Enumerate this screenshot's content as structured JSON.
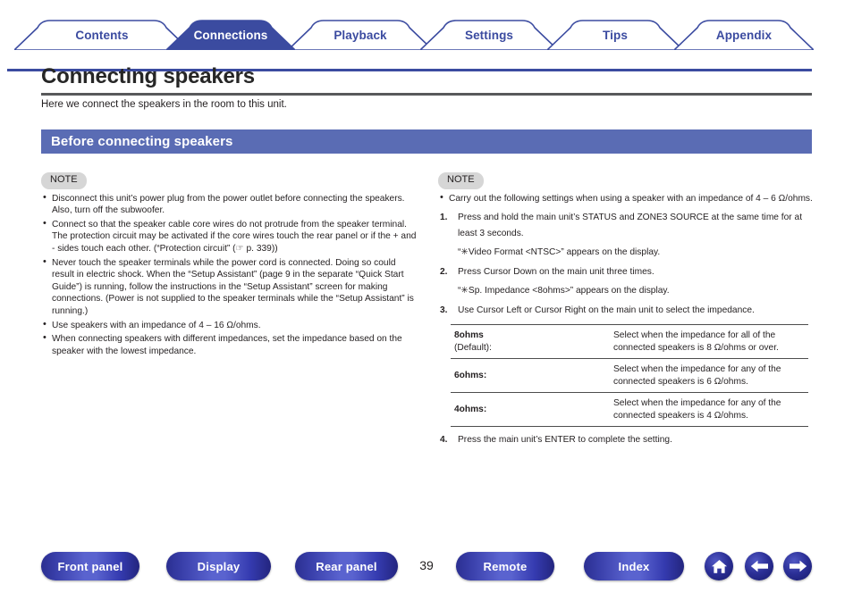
{
  "nav": {
    "tabs": [
      {
        "label": "Contents",
        "active": false
      },
      {
        "label": "Connections",
        "active": true
      },
      {
        "label": "Playback",
        "active": false
      },
      {
        "label": "Settings",
        "active": false
      },
      {
        "label": "Tips",
        "active": false
      },
      {
        "label": "Appendix",
        "active": false
      }
    ]
  },
  "page": {
    "title": "Connecting speakers",
    "lead": "Here we connect the speakers in the room to this unit.",
    "section_heading": "Before connecting speakers",
    "number": "39"
  },
  "left_column": {
    "note_label": "NOTE",
    "bullets": [
      "Disconnect this unit’s power plug from the power outlet before connecting the speakers. Also, turn off the subwoofer.",
      "Connect so that the speaker cable core wires do not protrude from the speaker terminal. The protection circuit may be activated if the core wires touch the rear panel or if the + and - sides touch each other. (“Protection circuit” (☞ p. 339))",
      "Never touch the speaker terminals while the power cord is connected. Doing so could result in electric shock. When the “Setup Assistant” (page 9 in the separate “Quick Start Guide”) is running, follow the instructions in the “Setup Assistant” screen for making connections. (Power is not supplied to the speaker terminals while the “Setup Assistant” is running.)",
      "Use speakers with an impedance of 4 – 16 Ω/ohms.",
      "When connecting speakers with different impedances, set the impedance based on the speaker with the lowest impedance."
    ]
  },
  "right_column": {
    "note_label": "NOTE",
    "intro_bullet": "Carry out the following settings when using a speaker with an impedance of 4 – 6 Ω/ohms.",
    "steps": [
      {
        "number": "1.",
        "text": "Press and hold the main unit’s STATUS and ZONE3 SOURCE at the same time for at least 3 seconds.",
        "result": "“✳Video Format <NTSC>” appears on the display."
      },
      {
        "number": "2.",
        "text": "Press Cursor Down on the main unit three times.",
        "result": "“✳Sp. Impedance <8ohms>” appears on the display."
      },
      {
        "number": "3.",
        "text": "Use Cursor Left or Cursor Right on the main unit to select the impedance.",
        "result": ""
      }
    ],
    "impedance_table": {
      "rows": [
        {
          "option": "8ohms",
          "option_suffix": "(Default):",
          "description": "Select when the impedance for all of the connected speakers is 8 Ω/ohms or over."
        },
        {
          "option": "6ohms:",
          "option_suffix": "",
          "description": "Select when the impedance for any of the connected speakers is 6 Ω/ohms."
        },
        {
          "option": "4ohms:",
          "option_suffix": "",
          "description": "Select when the impedance for any of the connected speakers is 4 Ω/ohms."
        }
      ]
    },
    "final_step": {
      "number": "4.",
      "text": "Press the main unit’s ENTER to complete the setting."
    }
  },
  "footer": {
    "buttons": [
      {
        "label": "Front panel"
      },
      {
        "label": "Display"
      },
      {
        "label": "Rear panel"
      },
      {
        "label": "Remote"
      },
      {
        "label": "Index"
      }
    ],
    "icons": [
      {
        "name": "home-icon"
      },
      {
        "name": "arrow-left-icon"
      },
      {
        "name": "arrow-right-icon"
      }
    ]
  },
  "colors": {
    "brand_blue": "#3b4ba0",
    "section_blue": "#5a6cb4",
    "note_gray": "#d6d6d6",
    "rule_gray": "#58595b"
  }
}
